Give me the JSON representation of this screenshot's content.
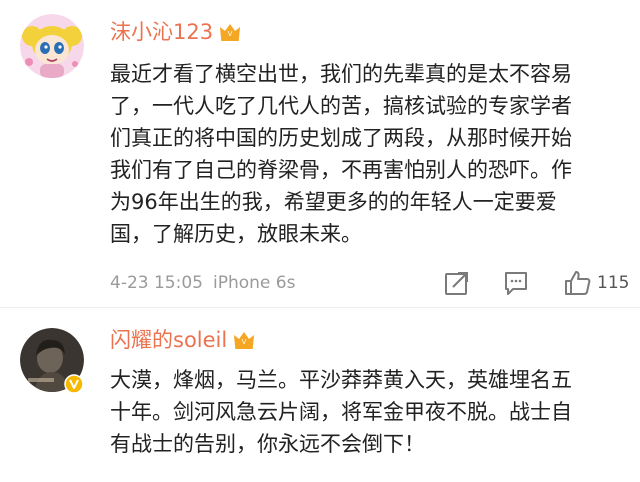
{
  "comments": [
    {
      "username": "沫小沁123",
      "text_lines": [
        "最近才看了横空出世，我们的先辈真的是太不容易",
        "了，一代人吃了几代人的苦，搞核试验的专家学者",
        "们真正的将中国的历史划成了两段，从那时候开始",
        "我们有了自己的脊梁骨，不再害怕别人的恐吓。作",
        "为96年出生的我，希望更多的的年轻人一定要爱",
        "国，了解历史，放眼未来。"
      ],
      "time": "4-23 15:05",
      "device": "iPhone 6s",
      "likes": "115"
    },
    {
      "username": "闪耀的soleil",
      "text_lines": [
        "大漠，烽烟，马兰。平沙莽莽黄入天，英雄埋名五",
        "十年。剑河风急云片阔，将军金甲夜不脱。战士自",
        "有战士的告别，你永远不会倒下！"
      ]
    }
  ],
  "colors": {
    "username": "#eb7350",
    "text": "#222222",
    "meta": "#9a9a9a",
    "crown": "#f5a623",
    "verified": "#f6b800"
  },
  "icons": [
    "vip-crown-icon",
    "share-icon",
    "comment-icon",
    "like-icon",
    "verified-badge-icon"
  ]
}
